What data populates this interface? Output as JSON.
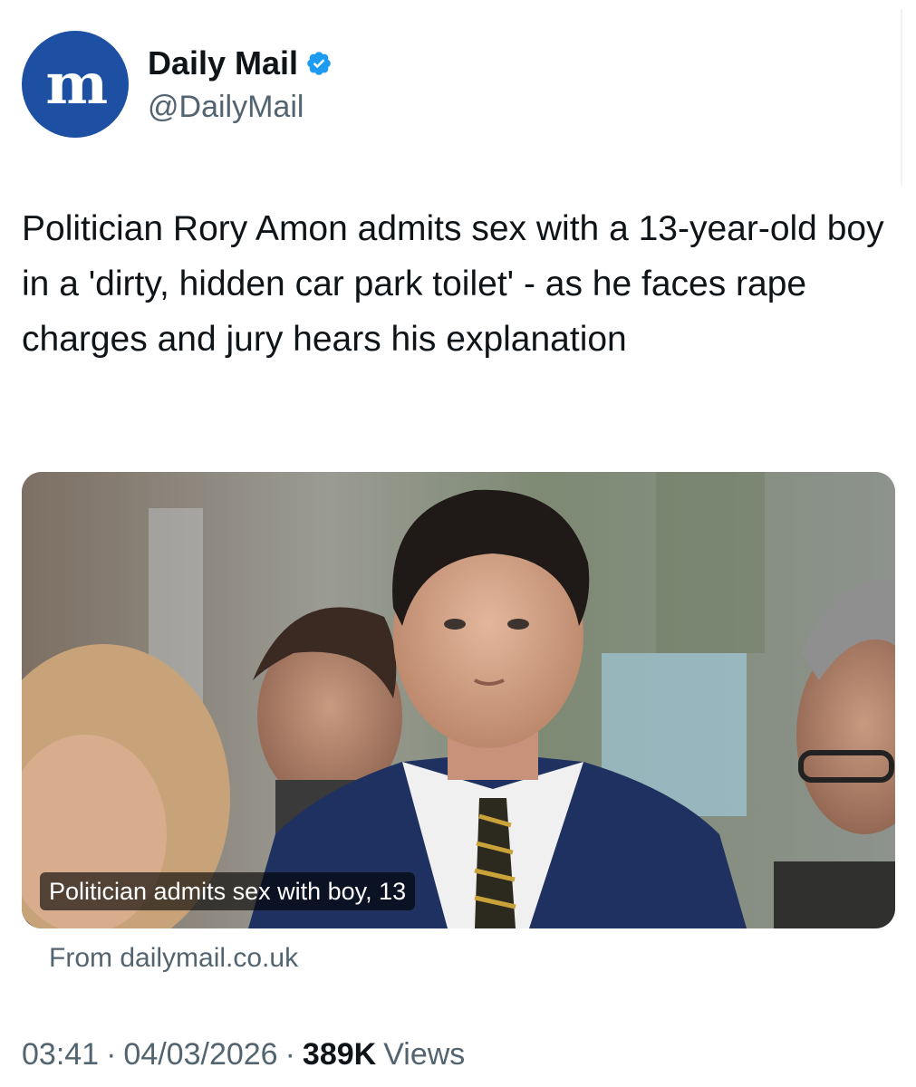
{
  "author": {
    "name": "Daily Mail",
    "handle": "@DailyMail",
    "avatar_glyph": "m",
    "avatar_color": "#1d4fa3",
    "verified_color": "#1d9bf0"
  },
  "tweet": {
    "text": "Politician Rory Amon admits sex with a 13-year-old boy in a 'dirty, hidden car park toilet' - as he faces rape charges and jury hears his explanation"
  },
  "card": {
    "caption": "Politician admits sex with boy, 13",
    "source": "From dailymail.co.uk"
  },
  "meta": {
    "time": "03:41",
    "date": "04/03/2026",
    "views_count": "389K",
    "views_label": "Views",
    "separator": "·"
  }
}
